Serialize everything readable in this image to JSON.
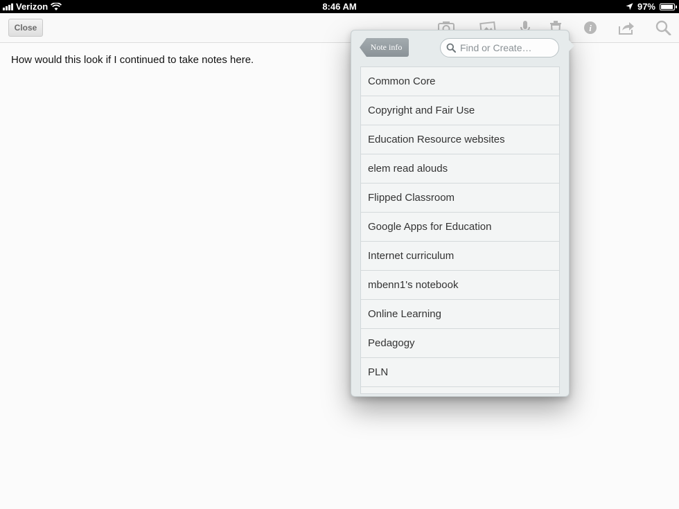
{
  "status_bar": {
    "carrier": "Verizon",
    "time": "8:46 AM",
    "battery": "97%",
    "battery_level": 0.97
  },
  "toolbar": {
    "close_label": "Close",
    "icons": [
      "camera-icon",
      "image-icon",
      "microphone-icon",
      "trash-icon",
      "info-icon",
      "share-icon",
      "search-icon"
    ]
  },
  "note": {
    "body": "How would this look if I continued to take notes here."
  },
  "popover": {
    "back_label": "Note info",
    "search_placeholder": "Find or Create…",
    "notebooks": [
      "Common Core",
      "Copyright and Fair Use",
      "Education Resource websites",
      "elem read alouds",
      "Flipped Classroom",
      "Google Apps for Education",
      "Internet curriculum",
      "mbenn1's notebook",
      "Online Learning",
      "Pedagogy",
      "PLN"
    ]
  }
}
